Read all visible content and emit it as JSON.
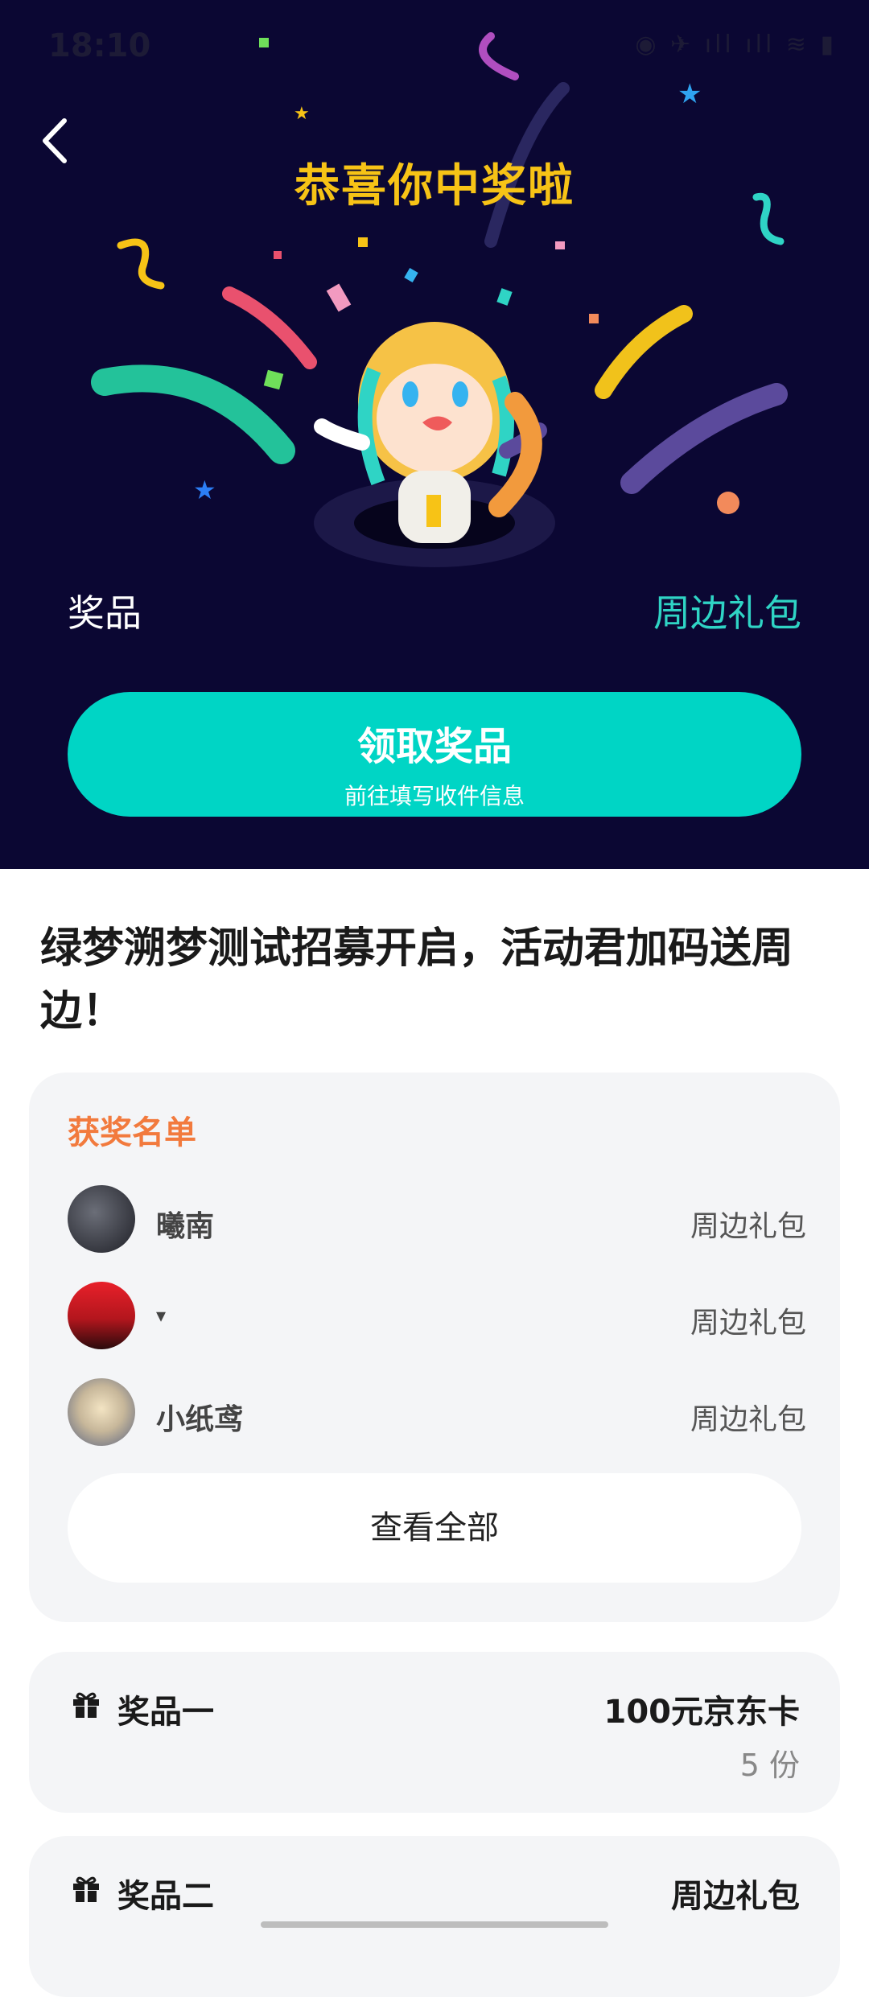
{
  "status_bar": {
    "time": "18:10",
    "icons": "◉ ✈ ıll ıll ≋ ▮"
  },
  "hero": {
    "title": "恭喜你中奖啦",
    "prize_label": "奖品",
    "prize_value": "周边礼包",
    "claim_button": {
      "label": "领取奖品",
      "sublabel": "前往填写收件信息"
    }
  },
  "activity": {
    "title": "绿梦溯梦测试招募开启，活动君加码送周边！"
  },
  "winners": {
    "heading": "获奖名单",
    "list": [
      {
        "name": "曦南",
        "prize": "周边礼包"
      },
      {
        "name": "▾",
        "prize": "周边礼包"
      },
      {
        "name": "小纸鸢",
        "prize": "周边礼包"
      }
    ],
    "view_all": "查看全部"
  },
  "prizes": [
    {
      "name": "奖品一",
      "value": "100元京东卡",
      "count": "5 份"
    },
    {
      "name": "奖品二",
      "value": "周边礼包",
      "count": ""
    }
  ],
  "colors": {
    "hero_bg": "#0b0733",
    "accent": "#00d5c5",
    "title_yellow": "#f7c316",
    "winner_heading": "#f27a3d"
  }
}
